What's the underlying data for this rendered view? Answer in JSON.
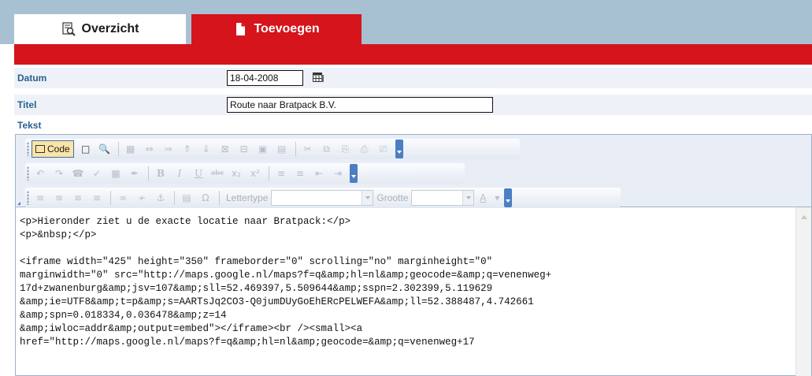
{
  "tabs": [
    {
      "label": "Overzicht",
      "icon": "preview-icon",
      "active": false
    },
    {
      "label": "Toevoegen",
      "icon": "new-page-icon",
      "active": true
    }
  ],
  "form": {
    "datum_label": "Datum",
    "datum_value": "18-04-2008",
    "titel_label": "Titel",
    "titel_value": "Route naar Bratpack B.V.",
    "tekst_label": "Tekst"
  },
  "toolbar": {
    "code_label": "Code",
    "font_label": "Lettertype",
    "size_label": "Grootte"
  },
  "editor": {
    "lines": [
      "<p>Hieronder ziet u de exacte locatie naar Bratpack:</p>",
      "<p>&nbsp;</p>",
      "",
      "<iframe width=\"425\" height=\"350\" frameborder=\"0\" scrolling=\"no\" marginheight=\"0\"",
      "marginwidth=\"0\" src=\"http://maps.google.nl/maps?f=q&amp;hl=nl&amp;geocode=&amp;q=venenweg+",
      "17d+zwanenburg&amp;jsv=107&amp;sll=52.469397,5.509644&amp;sspn=2.302399,5.119629",
      "&amp;ie=UTF8&amp;t=p&amp;s=AARTsJq2CO3-Q0jumDUyGoEhERcPELWEFA&amp;ll=52.388487,4.742661",
      "&amp;spn=0.018334,0.036478&amp;z=14",
      "&amp;iwloc=addr&amp;output=embed\"></iframe><br /><small><a",
      "href=\"http://maps.google.nl/maps?f=q&amp;hl=nl&amp;geocode=&amp;q=venenweg+17"
    ]
  },
  "colors": {
    "accent_red": "#d5141c",
    "tab_strip": "#a7c1d3",
    "label_blue": "#29628d",
    "row_bg": "#eef2f8"
  }
}
